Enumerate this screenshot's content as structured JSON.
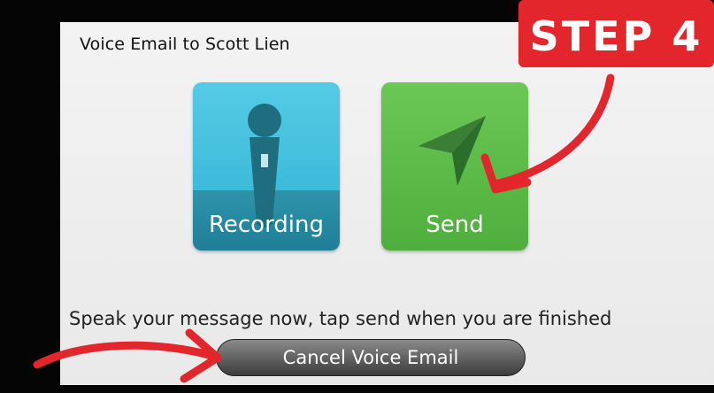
{
  "dialog": {
    "title": "Voice Email to Scott Lien",
    "status_text": "Speak your message now, tap send when you are finished",
    "cancel_label": "Cancel Voice Email"
  },
  "tiles": [
    {
      "label": "Recording",
      "icon": "microphone-icon",
      "color": "#3fbfdc"
    },
    {
      "label": "Send",
      "icon": "paper-plane-icon",
      "color": "#5cbb47"
    }
  ],
  "annotation": {
    "step_label": "STEP 4",
    "color": "#e3262b"
  }
}
